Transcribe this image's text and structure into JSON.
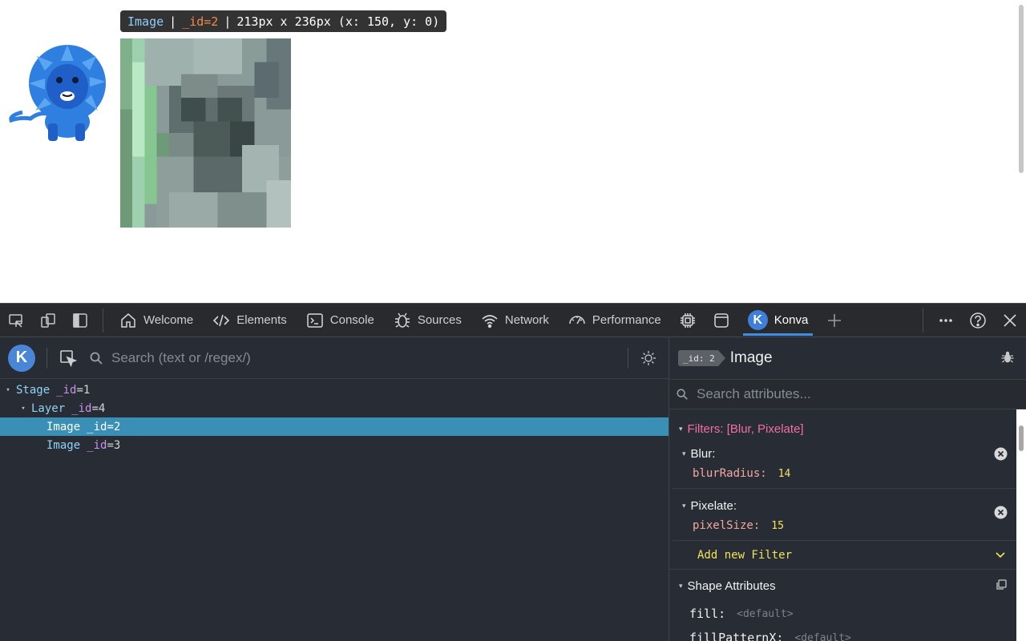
{
  "tooltip": {
    "node_name": "Image",
    "sep1": "|",
    "id_label": "_id=2",
    "sep2": "|",
    "info": "213px x 236px (x: 150, y: 0)"
  },
  "devtools": {
    "tabs": [
      {
        "label": "Welcome",
        "icon": "home-icon"
      },
      {
        "label": "Elements",
        "icon": "code-icon"
      },
      {
        "label": "Console",
        "icon": "console-icon"
      },
      {
        "label": "Sources",
        "icon": "bug-icon"
      },
      {
        "label": "Network",
        "icon": "wifi-icon"
      },
      {
        "label": "Performance",
        "icon": "gauge-icon"
      },
      {
        "label": "",
        "icon": "chip-icon"
      },
      {
        "label": "",
        "icon": "application-icon"
      },
      {
        "label": "Konva",
        "icon": "konva-logo",
        "active": true
      }
    ],
    "konva_badge": "K",
    "add_tab": "+"
  },
  "konva": {
    "logo": "K",
    "search_placeholder": "Search (text or /regex/)",
    "tree": [
      {
        "name": "Stage",
        "id_key": "_id",
        "eq": "=",
        "id_val": "1",
        "caret": "▾"
      },
      {
        "name": "Layer",
        "id_key": "_id",
        "eq": "=",
        "id_val": "4",
        "caret": "▾"
      },
      {
        "name": "Image",
        "id_key": "_id",
        "eq": "=",
        "id_val": "2",
        "caret": "",
        "selected": true
      },
      {
        "name": "Image",
        "id_key": "_id",
        "eq": "=",
        "id_val": "3",
        "caret": ""
      }
    ],
    "detail": {
      "id_chip": "_id: 2",
      "title": "Image",
      "attr_search_placeholder": "Search attributes...",
      "filters_title": "Filters: [Blur, Pixelate]",
      "filters": [
        {
          "name": "Blur:",
          "prop": "blurRadius:",
          "value": "14"
        },
        {
          "name": "Pixelate:",
          "prop": "pixelSize:",
          "value": "15"
        }
      ],
      "add_filter": "Add new Filter",
      "shape_title": "Shape Attributes",
      "attrs": [
        {
          "key": "fill:",
          "value": "<default>"
        },
        {
          "key": "fillPatternX:",
          "value": "<default>"
        }
      ]
    }
  },
  "colors": {
    "accent": "#3e8de8",
    "tree_selected": "#3a8fb7",
    "filters_pink": "#f06fa8",
    "value_yellow": "#f5e35a",
    "devtools_bg": "#282c34"
  }
}
